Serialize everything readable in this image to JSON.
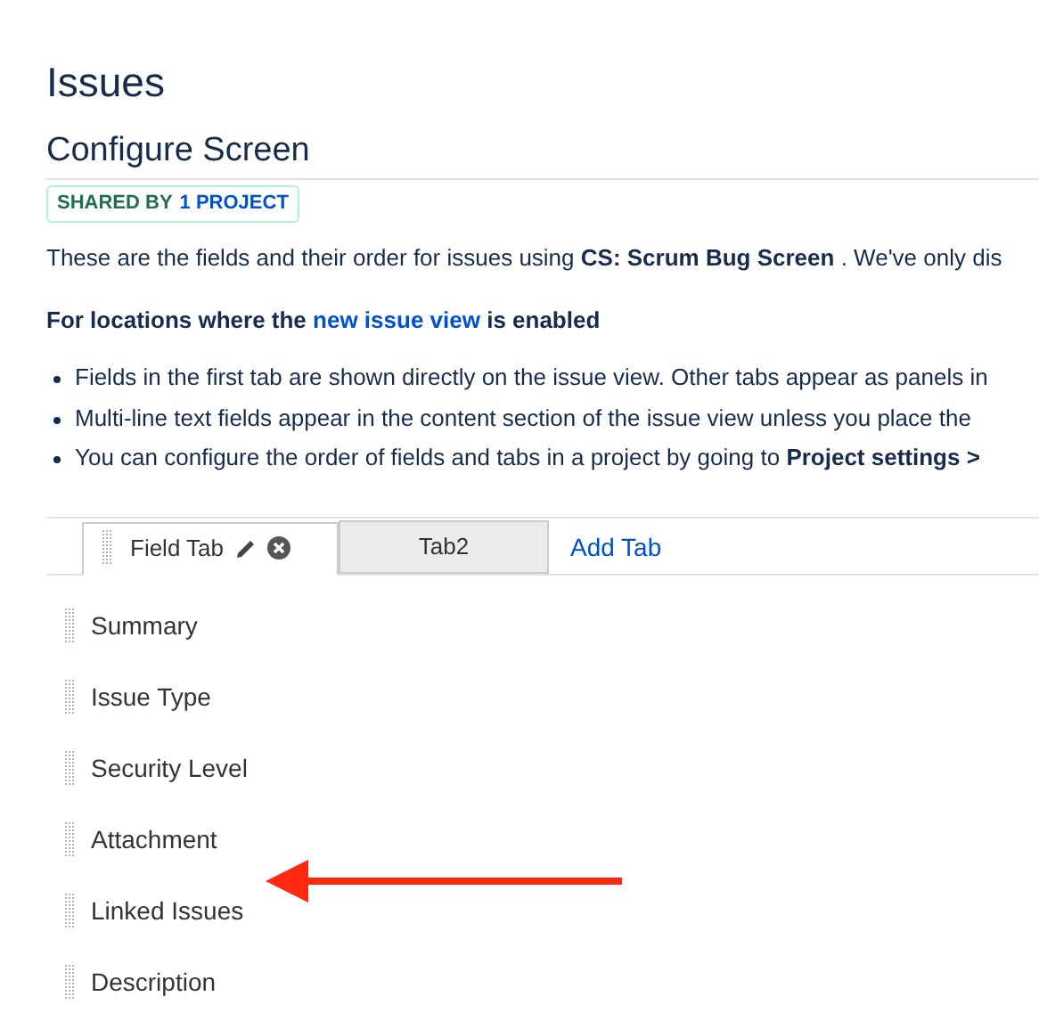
{
  "page_title": "Issues",
  "section_title": "Configure Screen",
  "badge": {
    "label": "SHARED BY",
    "link": "1 PROJECT"
  },
  "intro": "These are the fields and their order for issues using **CS: Scrum Bug Screen** . We've only dis",
  "notice": {
    "before": "For locations where the",
    "link": "new issue view",
    "after": "is enabled"
  },
  "bullets": [
    "Fields in the first tab are shown directly on the issue view. Other tabs appear as panels in",
    "Multi-line text fields appear in the content section of the issue view unless you place the",
    "You can configure the order of fields and tabs in a project by going to **Project settings >**"
  ],
  "tabs": [
    {
      "label": "Field Tab",
      "selected": true
    },
    {
      "label": "Tab2",
      "selected": false
    }
  ],
  "add_tab": "Add Tab",
  "fields": [
    "Summary",
    "Issue Type",
    "Security Level",
    "Attachment",
    "Linked Issues",
    "Description"
  ]
}
